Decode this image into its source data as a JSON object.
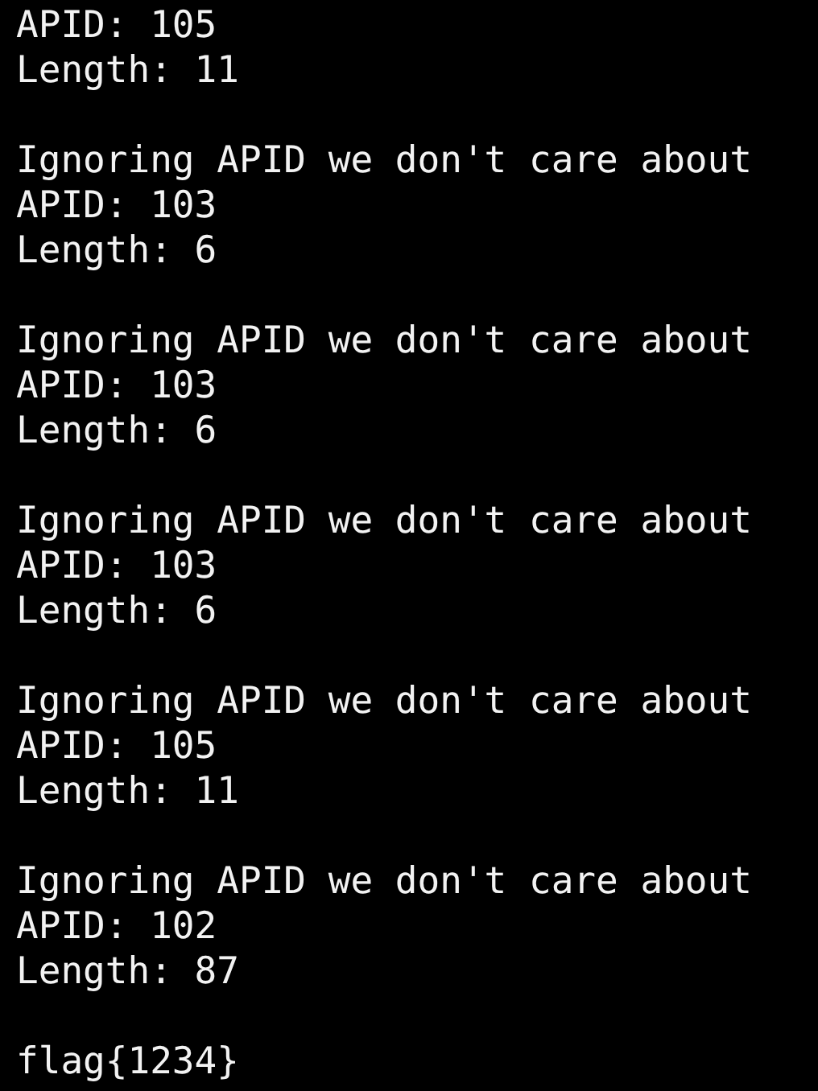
{
  "terminal": {
    "blocks": [
      {
        "lines": [
          "APID: 105",
          "Length: 11"
        ]
      },
      {
        "lines": [
          "Ignoring APID we don't care about",
          "APID: 103",
          "Length: 6"
        ]
      },
      {
        "lines": [
          "Ignoring APID we don't care about",
          "APID: 103",
          "Length: 6"
        ]
      },
      {
        "lines": [
          "Ignoring APID we don't care about",
          "APID: 103",
          "Length: 6"
        ]
      },
      {
        "lines": [
          "Ignoring APID we don't care about",
          "APID: 105",
          "Length: 11"
        ]
      },
      {
        "lines": [
          "Ignoring APID we don't care about",
          "APID: 102",
          "Length: 87"
        ]
      },
      {
        "lines": [
          "flag{1234}"
        ]
      }
    ]
  }
}
